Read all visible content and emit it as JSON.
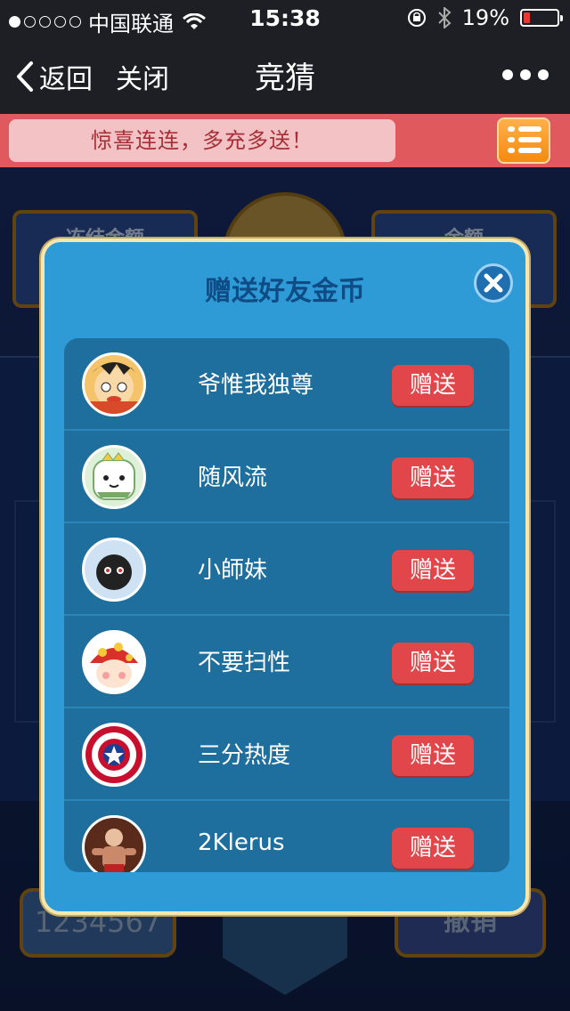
{
  "status_bar": {
    "carrier": "中国联通",
    "time": "15:38",
    "battery": "19%",
    "battery_level": 0.19,
    "signal_dots": 5,
    "signal_filled": 1
  },
  "nav": {
    "back_label": "返回",
    "close_label": "关闭",
    "title": "竞猜"
  },
  "promo": {
    "text": "惊喜连连，多充多送！"
  },
  "background": {
    "frozen_label": "冻结金额",
    "balance_label": "余额",
    "code": "1234567",
    "undo_label": "撤销"
  },
  "modal": {
    "title": "赠送好友金币",
    "friends": [
      {
        "name": "爷惟我独尊",
        "button": "赠送",
        "avatar_icon": "cartoon-boy-avatar"
      },
      {
        "name": "随风流",
        "button": "赠送",
        "avatar_icon": "dino-avatar"
      },
      {
        "name": "小師妹",
        "button": "赠送",
        "avatar_icon": "fluffball-avatar"
      },
      {
        "name": "不要扫性",
        "button": "赠送",
        "avatar_icon": "mushroom-avatar"
      },
      {
        "name": "三分热度",
        "button": "赠送",
        "avatar_icon": "shield-avatar"
      },
      {
        "name": "2Klerus",
        "button": "赠送",
        "avatar_icon": "fighter-avatar"
      }
    ]
  },
  "colors": {
    "bar": "#1e1f24",
    "promo": "#e0595c",
    "modal": "#2f9bd6",
    "list": "#1f6f9e",
    "button": "#e1474a"
  }
}
